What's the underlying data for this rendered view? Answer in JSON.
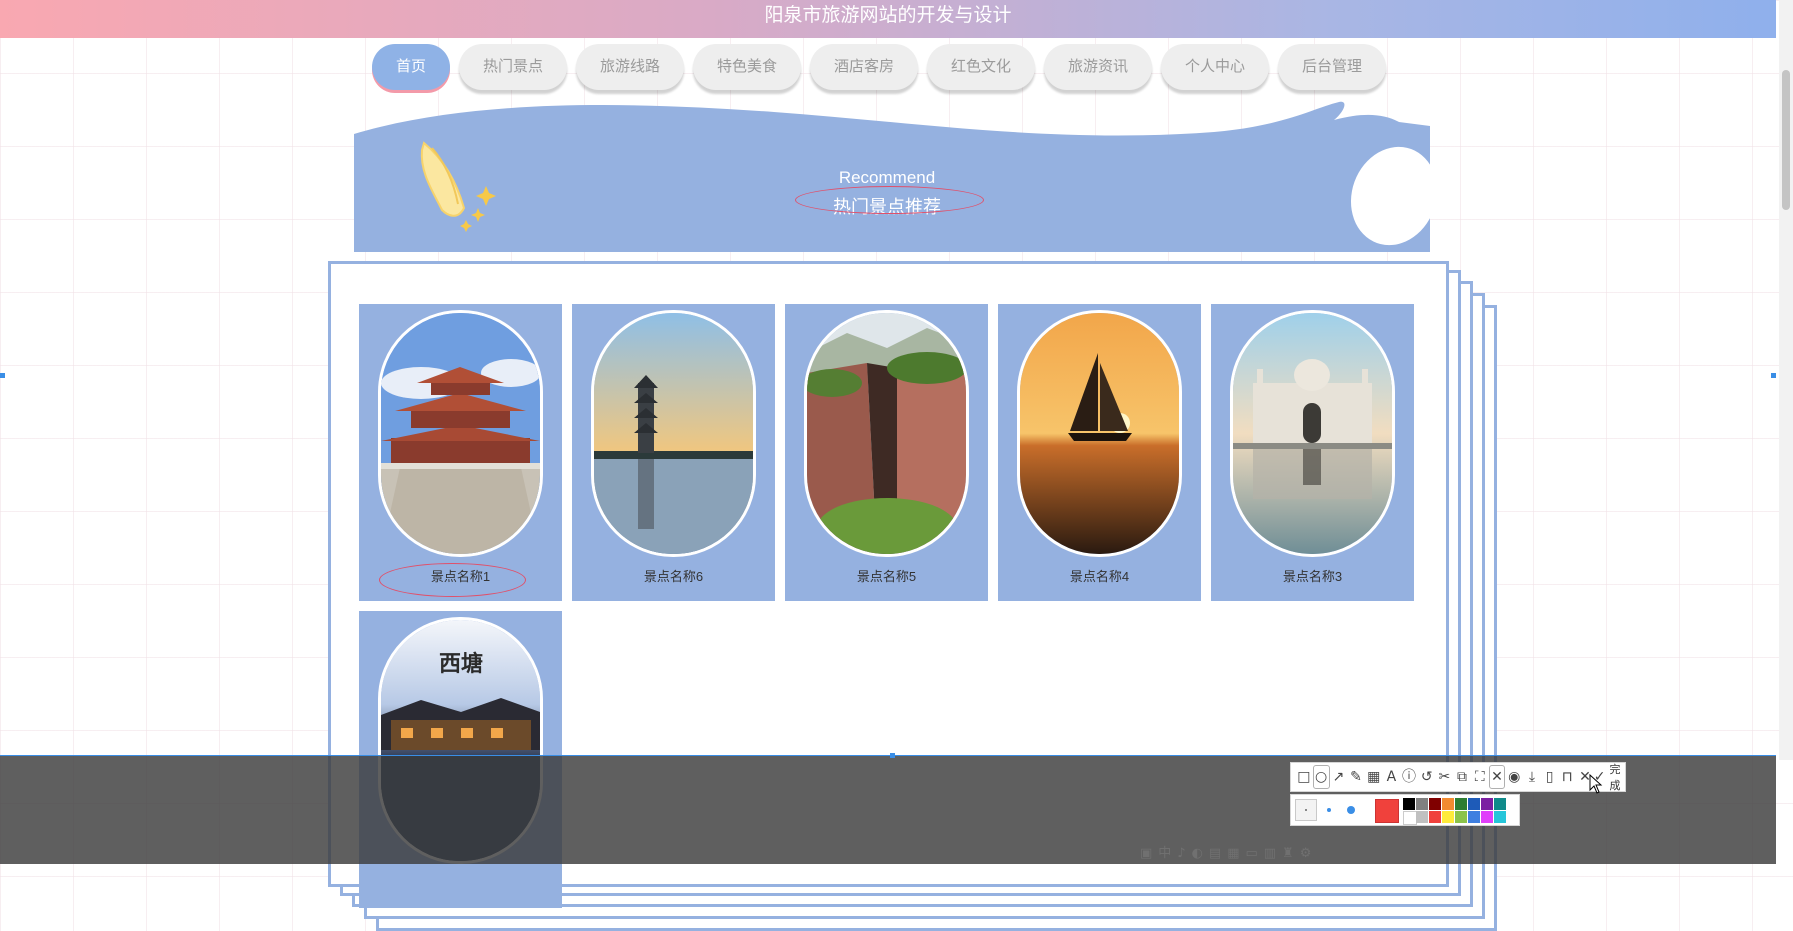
{
  "header": {
    "title": "阳泉市旅游网站的开发与设计"
  },
  "nav": {
    "items": [
      {
        "label": "首页",
        "active": true
      },
      {
        "label": "热门景点"
      },
      {
        "label": "旅游线路"
      },
      {
        "label": "特色美食"
      },
      {
        "label": "酒店客房"
      },
      {
        "label": "红色文化"
      },
      {
        "label": "旅游资讯"
      },
      {
        "label": "个人中心"
      },
      {
        "label": "后台管理"
      }
    ]
  },
  "banner": {
    "title_en": "Recommend",
    "title_cn": "热门景点推荐"
  },
  "spots": [
    {
      "name": "景点名称1",
      "image": "chinese-pavilion-photo"
    },
    {
      "name": "景点名称6",
      "image": "pagoda-lake-photo"
    },
    {
      "name": "景点名称5",
      "image": "cliff-canyon-photo"
    },
    {
      "name": "景点名称4",
      "image": "sailboat-sunset-photo"
    },
    {
      "name": "景点名称3",
      "image": "palace-reflection-photo"
    },
    {
      "name": "",
      "image": "water-town-night-photo",
      "logo_text": "西塘"
    }
  ],
  "screenshot_tool": {
    "done_label": "完成",
    "tools": [
      "rectangle-icon",
      "ellipse-icon",
      "arrow-icon",
      "pen-icon",
      "mosaic-icon",
      "text-icon",
      "number-icon",
      "undo-icon",
      "scissors-icon",
      "ocr-icon",
      "fullscreen-icon",
      "pin-icon",
      "record-icon",
      "download-icon",
      "long-screenshot-icon",
      "bookmark-icon",
      "close-icon",
      "check-icon"
    ],
    "current_color": "#f0413c",
    "colors": [
      "#000000",
      "#808080",
      "#800000",
      "#f28b30",
      "#2e7d32",
      "#1e5bb8",
      "#7b1fa2",
      "#0f8a8a",
      "#ffffff",
      "#c0c0c0",
      "#f0413c",
      "#ffeb3b",
      "#8bc34a",
      "#3f7fe0",
      "#e040fb",
      "#26c6da"
    ]
  },
  "colors": {
    "accent": "#95b1e0",
    "nav_active": "#8fb2e6",
    "annotation": "#e0506a"
  }
}
